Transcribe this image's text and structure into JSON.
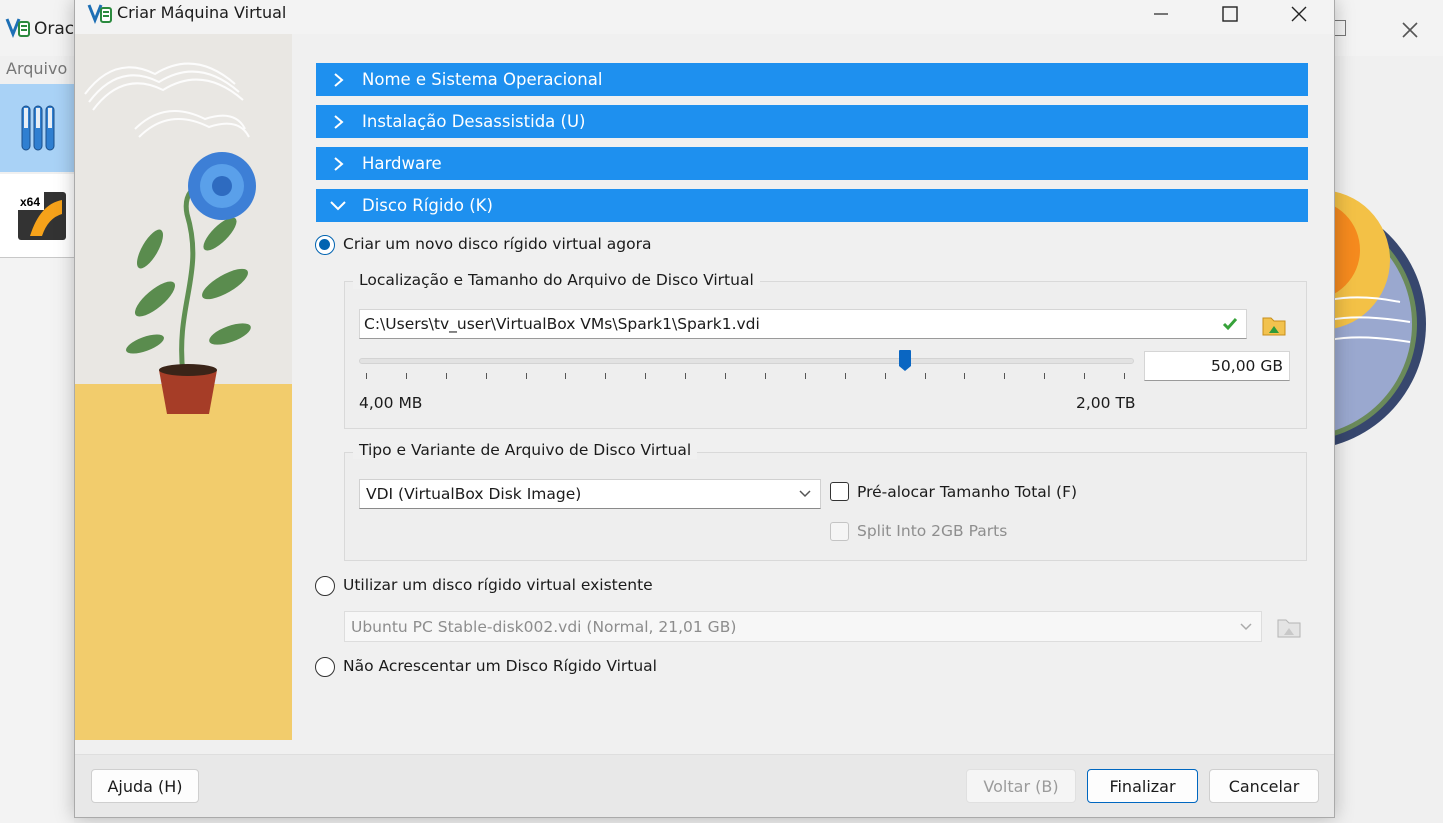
{
  "background_window": {
    "title": "Orac",
    "menu": "Arquivo"
  },
  "dialog": {
    "title": "Criar Máquina Virtual",
    "sections": [
      {
        "label": "Nome e Sistema Operacional",
        "expanded": false
      },
      {
        "label": "Instalação Desassistida (U)",
        "expanded": false
      },
      {
        "label": "Hardware",
        "expanded": false
      },
      {
        "label": "Disco Rígido (K)",
        "expanded": true
      }
    ],
    "disk": {
      "option_create": "Criar um novo disco rígido virtual agora",
      "location_group": {
        "title": "Localização e Tamanho do Arquivo de Disco Virtual",
        "path": "C:\\Users\\tv_user\\VirtualBox VMs\\Spark1\\Spark1.vdi",
        "size_value": "50,00 GB",
        "slider_fraction": 0.705,
        "min_label": "4,00 MB",
        "max_label": "2,00 TB"
      },
      "type_group": {
        "title": "Tipo e Variante de Arquivo de Disco Virtual",
        "format": "VDI (VirtualBox Disk Image)",
        "preallocate": "Pré-alocar Tamanho Total (F)",
        "preallocate_checked": false,
        "split": "Split Into 2GB Parts",
        "split_checked": false
      },
      "option_existing": "Utilizar um disco rígido virtual existente",
      "existing_disk": "Ubuntu PC Stable-disk002.vdi (Normal, 21,01 GB)",
      "option_none": "Não Acrescentar um Disco Rígido Virtual",
      "selected_option": "create"
    },
    "buttons": {
      "help": "Ajuda (H)",
      "back": "Voltar (B)",
      "finish": "Finalizar",
      "cancel": "Cancelar"
    }
  },
  "colors": {
    "accent": "#1e90ef",
    "radio_selected": "#0063b1",
    "default_button_border": "#0067c0"
  }
}
